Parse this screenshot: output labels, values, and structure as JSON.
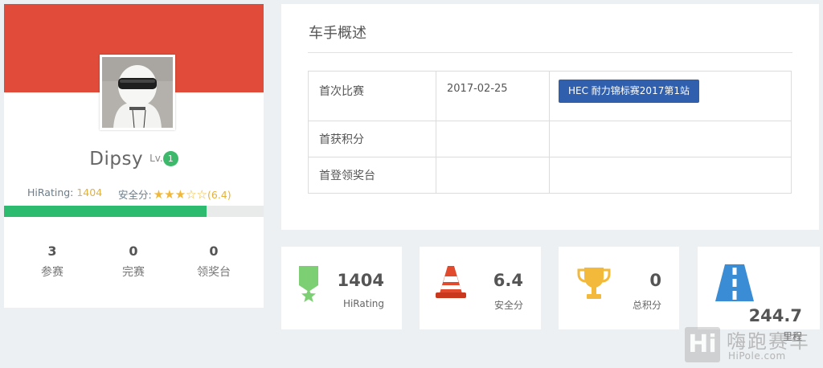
{
  "profile": {
    "username": "Dipsy",
    "level_prefix": "Lv.",
    "level": "1",
    "hirating_label": "HiRating: ",
    "hirating_value": "1404",
    "safety_label": "安全分:",
    "safety_stars": 3,
    "safety_stars_max": 5,
    "safety_value": "(6.4)",
    "progress_fraction": 0.78,
    "stats": [
      {
        "value": "3",
        "label": "参赛"
      },
      {
        "value": "0",
        "label": "完赛"
      },
      {
        "value": "0",
        "label": "领奖台"
      }
    ],
    "colors": {
      "banner": "#e04c39",
      "progress": "#2dbb6f",
      "level_badge": "#3cb96a"
    }
  },
  "overview": {
    "title": "车手概述",
    "rows": [
      {
        "label": "首次比赛",
        "date": "2017-02-25",
        "race": "HEC 耐力锦标赛2017第1站"
      },
      {
        "label": "首获积分",
        "date": "",
        "race": ""
      },
      {
        "label": "首登领奖台",
        "date": "",
        "race": ""
      }
    ]
  },
  "metrics": [
    {
      "icon": "ribbon-icon",
      "value": "1404",
      "label": "HiRating"
    },
    {
      "icon": "traffic-cone-icon",
      "value": "6.4",
      "label": "安全分"
    },
    {
      "icon": "trophy-icon",
      "value": "0",
      "label": "总积分"
    },
    {
      "icon": "road-icon",
      "value": "244.7",
      "label": "里程"
    }
  ],
  "watermark": {
    "logo": "Hi",
    "title": "嗨跑赛车",
    "url": "HiPole.com"
  }
}
